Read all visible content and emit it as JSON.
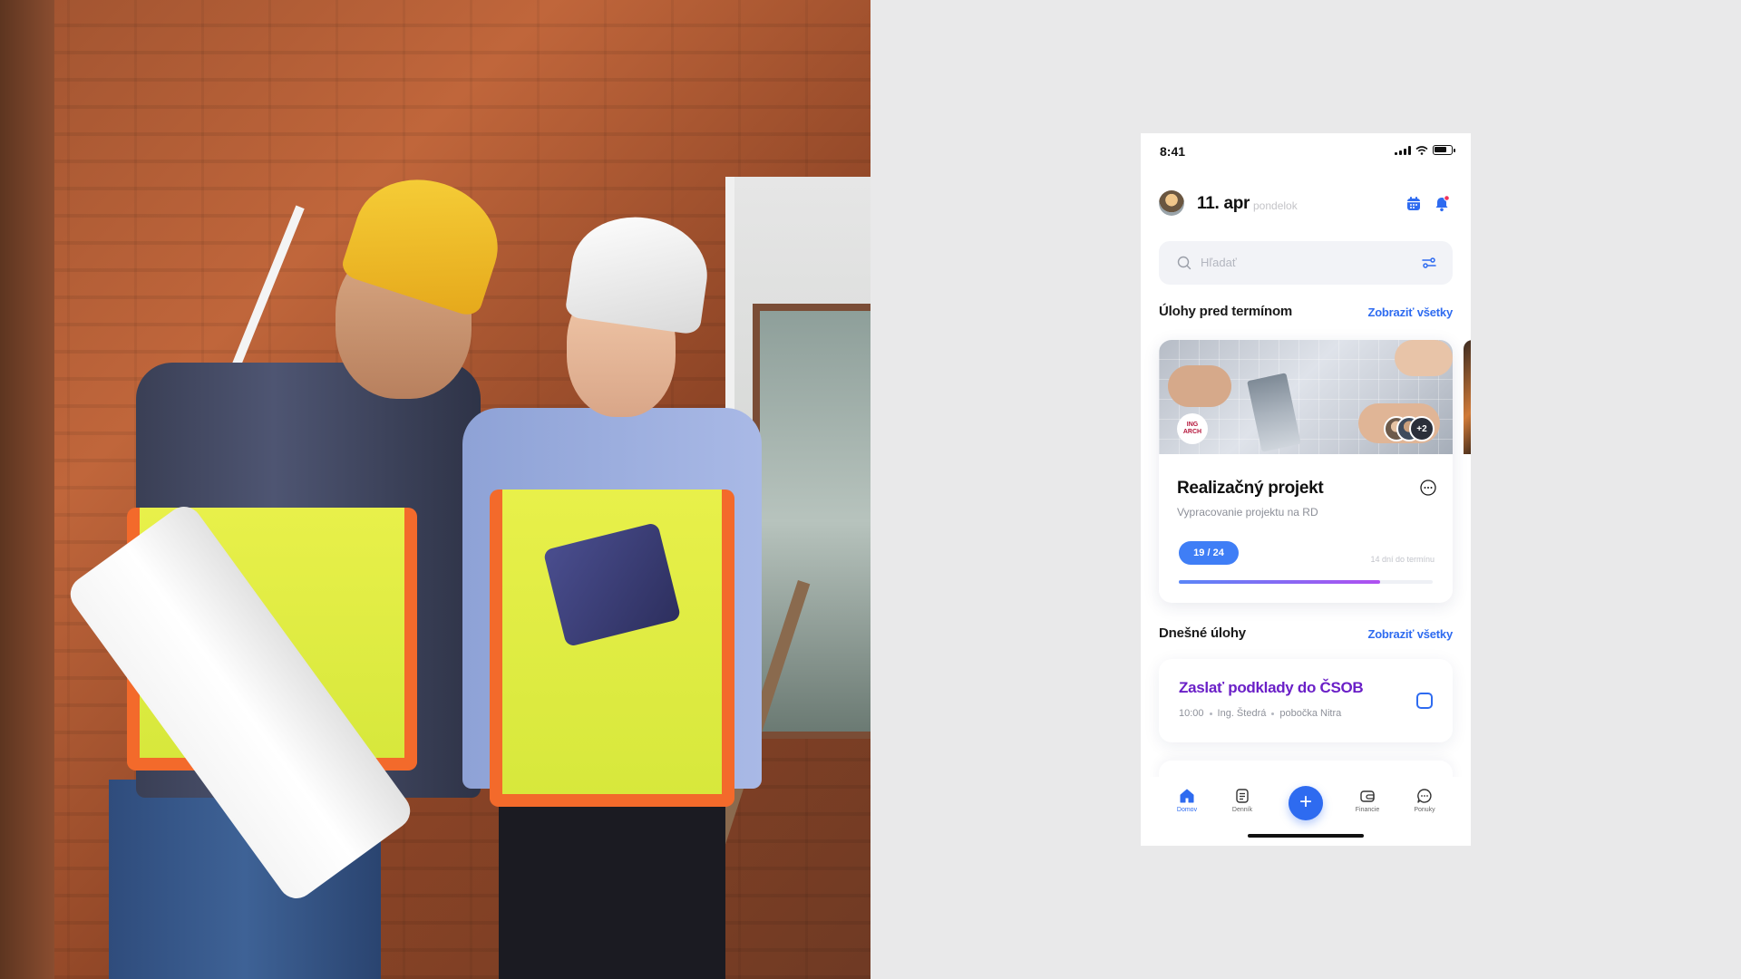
{
  "status_bar": {
    "time": "8:41"
  },
  "header": {
    "date": "11. apr",
    "weekday": "pondelok"
  },
  "search": {
    "placeholder": "Hľadať"
  },
  "overdue_section": {
    "title": "Úlohy pred termínom",
    "link": "Zobraziť všetky",
    "card": {
      "logo_line1": "ING",
      "logo_line2": "ARCH",
      "extra_members": "+2",
      "title": "Realizačný projekt",
      "subtitle": "Vypracovanie projektu na RD",
      "progress_label": "19 / 24",
      "progress_done": 19,
      "progress_total": 24,
      "deadline": "14 dní do termínu"
    }
  },
  "today_section": {
    "title": "Dnešné úlohy",
    "link": "Zobraziť všetky",
    "task": {
      "title": "Zaslať podklady do ČSOB",
      "time": "10:00",
      "person": "Ing. Štedrá",
      "place": "pobočka Nitra"
    }
  },
  "tabbar": {
    "home": "Domov",
    "diary": "Denník",
    "add": "+",
    "finance": "Financie",
    "offers": "Ponuky"
  },
  "colors": {
    "accent": "#2e6bf0",
    "task_title": "#6a1fc7",
    "notification_dot": "#f0325a",
    "progress_start": "#5a86f7",
    "progress_end": "#b04ff0"
  }
}
